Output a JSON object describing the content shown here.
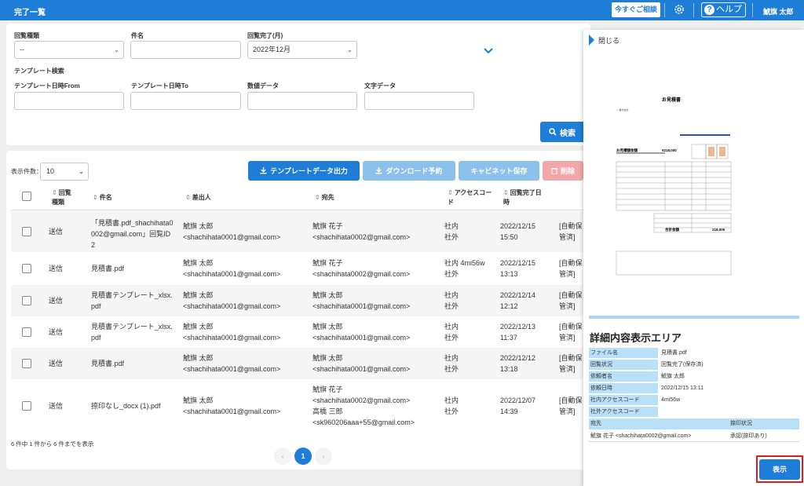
{
  "header": {
    "title": "完了一覧",
    "consult_label": "今すぐご相談",
    "help_label": "ヘルプ",
    "user_name": "鯱旗 太郎"
  },
  "search": {
    "labels": {
      "kind": "回覧種類",
      "subject": "件名",
      "completed_month": "回覧完了(月)",
      "template_search": "テンプレート検索",
      "template_from": "テンプレート日時From",
      "template_to": "テンプレート日時To",
      "numeric": "数値データ",
      "text": "文字データ"
    },
    "values": {
      "kind": "--",
      "completed_month": "2022年12月"
    },
    "search_button": "検索"
  },
  "list": {
    "per_page_label": "表示件数：",
    "per_page_value": "10",
    "actions": {
      "template_export": "テンプレートデータ出力",
      "download_reserve": "ダウンロード予約",
      "cabinet_save": "キャビネット保存",
      "delete": "削除"
    },
    "columns": {
      "kind": "回覧種類",
      "subject": "件名",
      "sender": "差出人",
      "recipient": "宛先",
      "access_code": "アクセスコード",
      "completed_at": "回覧完了日時"
    },
    "rows": [
      {
        "kind": "送信",
        "subject": "「見積書.pdf_shachihata0002@gmail.com」回覧ID2",
        "sender_name": "鯱旗 太郎",
        "sender_email": "<shachihata0001@gmail.com>",
        "recipient_lines": [
          "鯱旗 花子",
          "<shachihata0002@gmail.com>"
        ],
        "access_lines": [
          "社内",
          "社外"
        ],
        "date": "2022/12/15",
        "time": "15:50",
        "extra": [
          "[自動保",
          "管済]"
        ]
      },
      {
        "kind": "送信",
        "subject": "見積書.pdf",
        "sender_name": "鯱旗 太郎",
        "sender_email": "<shachihata0001@gmail.com>",
        "recipient_lines": [
          "鯱旗 花子",
          "<shachihata0002@gmail.com>"
        ],
        "access_lines": [
          "社内 4mi56w",
          "社外"
        ],
        "date": "2022/12/15",
        "time": "13:13",
        "extra": [
          "[自動保",
          "管済]"
        ]
      },
      {
        "kind": "送信",
        "subject": "見積書テンプレート_xlsx.pdf",
        "sender_name": "鯱旗 太郎",
        "sender_email": "<shachihata0001@gmail.com>",
        "recipient_lines": [
          "鯱旗 太郎",
          "<shachihata0001@gmail.com>"
        ],
        "access_lines": [
          "社内",
          "社外"
        ],
        "date": "2022/12/14",
        "time": "12:12",
        "extra": [
          "[自動保",
          "管済]"
        ]
      },
      {
        "kind": "送信",
        "subject": "見積書テンプレート_xlsx.pdf",
        "sender_name": "鯱旗 太郎",
        "sender_email": "<shachihata0001@gmail.com>",
        "recipient_lines": [
          "鯱旗 太郎",
          "<shachihata0001@gmail.com>"
        ],
        "access_lines": [
          "社内",
          "社外"
        ],
        "date": "2022/12/13",
        "time": "11:37",
        "extra": [
          "[自動保",
          "管済]"
        ]
      },
      {
        "kind": "送信",
        "subject": "見積書.pdf",
        "sender_name": "鯱旗 太郎",
        "sender_email": "<shachihata0001@gmail.com>",
        "recipient_lines": [
          "鯱旗 太郎",
          "<shachihata0001@gmail.com>"
        ],
        "access_lines": [
          "社内",
          "社外"
        ],
        "date": "2022/12/12",
        "time": "13:18",
        "extra": [
          "[自動保",
          "管済]"
        ]
      },
      {
        "kind": "送信",
        "subject": "捺印なし_docx (1).pdf",
        "sender_name": "鯱旗 太郎",
        "sender_email": "<shachihata0001@gmail.com>",
        "recipient_lines": [
          "鯱旗 花子",
          "<shachihata0002@gmail.com>",
          "高橋 三郎",
          "<sk960206aaa+55@gmail.com>"
        ],
        "access_lines": [
          "社内",
          "社外"
        ],
        "date": "2022/12/07",
        "time": "14:39",
        "extra": [
          "[自動保",
          "管済]"
        ]
      }
    ],
    "count_text": "6 件中 1 件から 6 件までを表示",
    "pagination": {
      "prev": "‹",
      "current": "1",
      "next": "›"
    }
  },
  "detail": {
    "close_label": "閉じる",
    "section_title": "詳細内容表示エリア",
    "fields": [
      {
        "key": "ファイル名",
        "value": "見積書.pdf"
      },
      {
        "key": "回覧状況",
        "value": "回覧完了(保存済)"
      },
      {
        "key": "依頼者名",
        "value": "鯱旗 太郎"
      },
      {
        "key": "依頼日時",
        "value": "2022/12/15 13:11"
      },
      {
        "key": "社内アクセスコード",
        "value": "4mi56w"
      },
      {
        "key": "社外アクセスコード",
        "value": ""
      }
    ],
    "destination_header": {
      "dest": "宛先",
      "stamp": "捺印状況"
    },
    "destination_row": {
      "dest": "鯱旗 花子 <shachihata0002@gmail.com>",
      "stamp": "承認(捺印あり)"
    },
    "show_button": "表示",
    "preview": {
      "doc_title": "お見積書",
      "amount_label": "お見積額金額",
      "amount_value": "¥218,000",
      "total_label": "合計金額",
      "total_value": "218,000",
      "company": "○○株式会社",
      "stamp_color": "#e07a2b"
    }
  }
}
